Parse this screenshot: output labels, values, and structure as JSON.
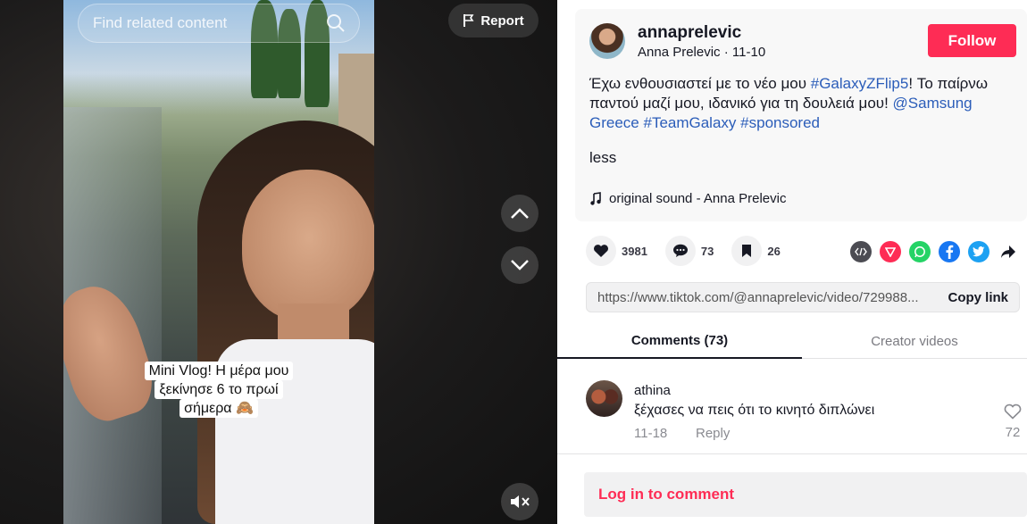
{
  "search": {
    "placeholder": "Find related content"
  },
  "video": {
    "report_label": "Report",
    "caption_lines": [
      "Mini Vlog! Η μέρα μου",
      "ξεκίνησε 6 το πρωί",
      "σήμερα 🙈"
    ]
  },
  "post": {
    "username": "annaprelevic",
    "display_name": "Anna Prelevic",
    "date": "11-10",
    "follow_label": "Follow",
    "desc_text_1": "Έχω ενθουσιαστεί με το νέο μου ",
    "tag_1": "#GalaxyZFlip5",
    "desc_text_2": "! Το παίρνω παντού μαζί μου, ιδανικό για τη δουλειά μου! ",
    "mention": "@Samsung Greece",
    "tag_2": "#TeamGalaxy",
    "tag_3": "#sponsored",
    "less_label": "less",
    "sound": "original sound - Anna Prelevic"
  },
  "actions": {
    "likes": "3981",
    "comments": "73",
    "saves": "26"
  },
  "share": {
    "url": "https://www.tiktok.com/@annaprelevic/video/729988...",
    "copy_label": "Copy link"
  },
  "tabs": {
    "comments": "Comments (73)",
    "creator": "Creator videos"
  },
  "comments": [
    {
      "user": "athina",
      "text": "ξέχασες να πεις ότι το κινητό διπλώνει",
      "date": "11-18",
      "reply": "Reply",
      "likes": "72"
    }
  ],
  "login": {
    "label": "Log in to comment"
  },
  "colors": {
    "accent": "#fe2c55",
    "link": "#2b5db9"
  }
}
